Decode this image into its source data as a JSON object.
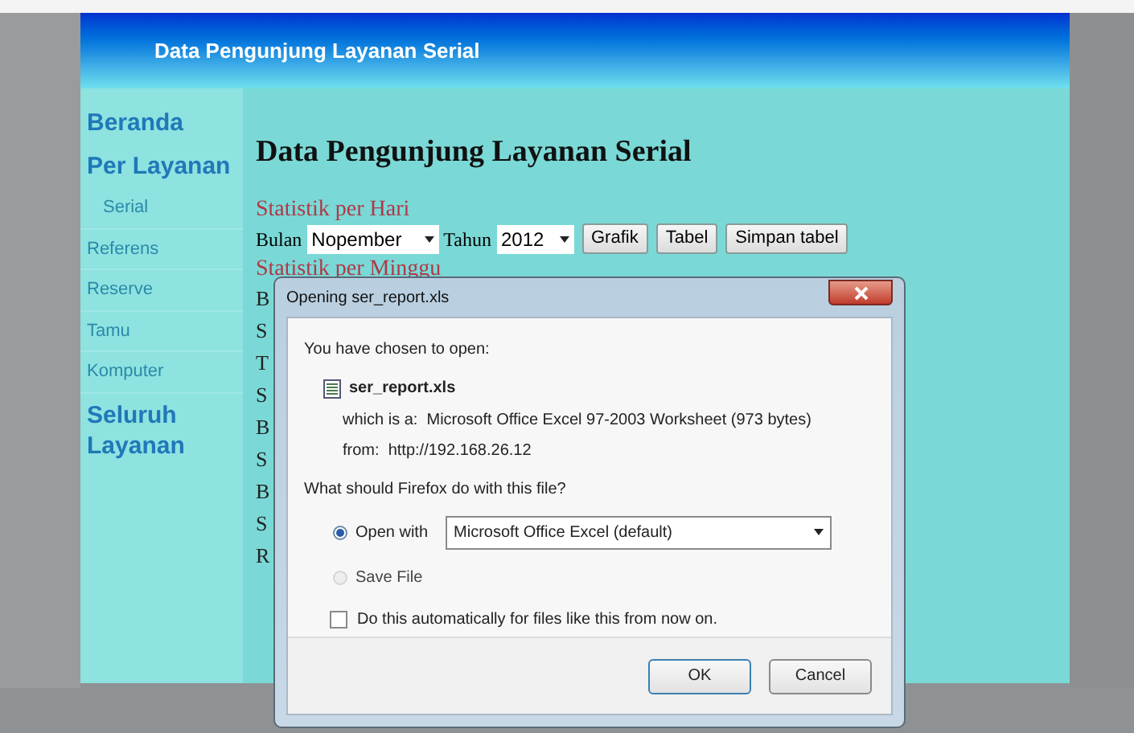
{
  "header": {
    "title": "Data Pengunjung Layanan Serial"
  },
  "sidebar": {
    "items": [
      {
        "label": "Beranda",
        "kind": "main"
      },
      {
        "label": "Per Layanan",
        "kind": "main"
      },
      {
        "label": "Serial",
        "kind": "sub"
      },
      {
        "label": "Referens",
        "kind": "item"
      },
      {
        "label": "Reserve",
        "kind": "item"
      },
      {
        "label": "Tamu",
        "kind": "item"
      },
      {
        "label": "Komputer",
        "kind": "item"
      },
      {
        "label": "Seluruh Layanan",
        "kind": "main"
      }
    ]
  },
  "content": {
    "heading": "Data Pengunjung Layanan Serial",
    "section_1": "Statistik per Hari",
    "form": {
      "month_label": "Bulan",
      "month_value": "Nopember",
      "year_label": "Tahun",
      "year_value": "2012",
      "buttons": [
        "Grafik",
        "Tabel",
        "Simpan tabel"
      ]
    },
    "section_2": "Statistik per Minggu",
    "covered_lines": [
      "B",
      "S",
      "T",
      "S",
      "B",
      "S",
      "B",
      "S",
      "R"
    ]
  },
  "dialog": {
    "title": "Opening ser_report.xls",
    "intro": "You have chosen to open:",
    "file_name": "ser_report.xls",
    "type_line": "which is a:  Microsoft Office Excel 97-2003 Worksheet (973 bytes)",
    "from_line": "from:  http://192.168.26.12",
    "question": "What should Firefox do with this file?",
    "options": [
      {
        "label": "Open with",
        "selected": true
      },
      {
        "label": "Save File",
        "selected": false
      }
    ],
    "app_choice": "Microsoft Office Excel (default)",
    "remember": {
      "label": "Do this automatically for files like this from now on.",
      "checked": false
    },
    "buttons": [
      "OK",
      "Cancel"
    ]
  }
}
